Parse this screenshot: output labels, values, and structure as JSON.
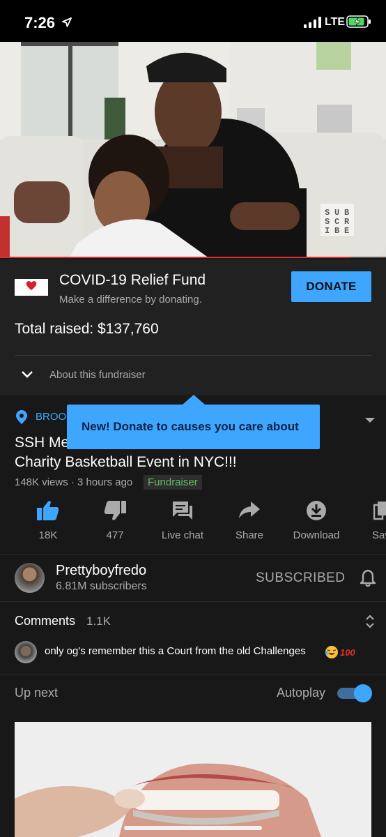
{
  "status_bar": {
    "time": "7:26",
    "network": "LTE"
  },
  "video": {
    "overlay_badge": [
      "S",
      "U",
      "B",
      "S",
      "C",
      "R",
      "I",
      "B",
      "E"
    ],
    "progress_fraction": 0.91
  },
  "fundraiser": {
    "title": "COVID-19 Relief Fund",
    "subtitle": "Make a difference by donating.",
    "donate_label": "DONATE",
    "total": "Total raised: $137,760",
    "about_label": "About this fundraiser"
  },
  "tooltip": {
    "text": "New! Donate to causes you care about"
  },
  "details": {
    "location": "BROO",
    "title_line1": "SSH Me",
    "title_line2": "Charity Basketball Event in NYC!!!",
    "meta": "148K views · 3 hours ago",
    "badge": "Fundraiser"
  },
  "actions": [
    {
      "label": "18K",
      "icon": "thumbs-up-icon"
    },
    {
      "label": "477",
      "icon": "thumbs-down-icon"
    },
    {
      "label": "Live chat",
      "icon": "live-chat-icon"
    },
    {
      "label": "Share",
      "icon": "share-icon"
    },
    {
      "label": "Download",
      "icon": "download-icon"
    },
    {
      "label": "Sav",
      "icon": "save-icon"
    }
  ],
  "channel": {
    "name": "Prettyboyfredo",
    "subscribers": "6.81M subscribers",
    "subscribed_label": "SUBSCRIBED"
  },
  "comments": {
    "heading": "Comments",
    "count": "1.1K",
    "top_comment": "only og's remember this a Court from the old Challenges"
  },
  "upnext": {
    "label": "Up next",
    "autoplay_label": "Autoplay",
    "autoplay_on": true
  },
  "colors": {
    "accent": "#3ea6ff",
    "background": "#181818",
    "panel": "#212121",
    "progress": "#e52d27",
    "badge_green": "#5fbf5f"
  }
}
